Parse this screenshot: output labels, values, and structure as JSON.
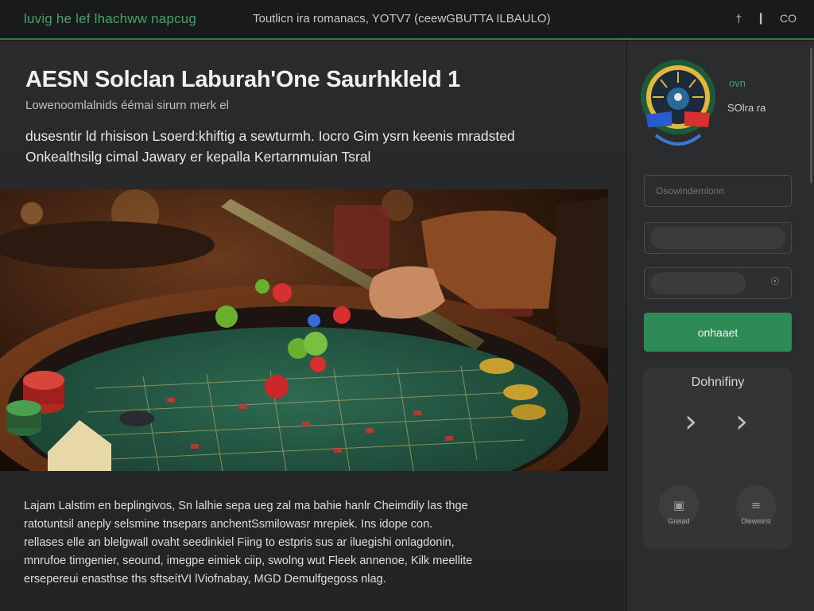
{
  "header": {
    "brand": "luvig he lef lhachww napcug",
    "tagline": "Toutlicn ira romanacs, YOTV7 (ceewGBUTTA ILBAULO)",
    "icons": [
      "share-icon",
      "info-icon",
      "settings-icon"
    ]
  },
  "article": {
    "title": "AESN Solclan Laburah'One Saurhkleld 1",
    "subtitle": "Lowenoomlalnids éémai sirurn merk el",
    "lead_lines": [
      "dusesntir ld rhisison Lsoerd:khiftig a sewturmh. Iocro Gim ysrn keenis mradsted",
      "Onkealthsilg cimal Jawary er kepalla Kertarnmuian Tsral"
    ],
    "body_lines": [
      "Lajam Lalstim en beplingivos, Sn lalhie sepa ueg zal ma bahie hanlr Cheimdily las thge",
      "ratotuntsil aneply selsmine tnsepars anchentSsmilowasr mrepiek. Ins idope con.",
      "rellases elle an blelgwall ovaht seedinkiel Fiing to estpris sus ar iluegishi onlagdonin,",
      "mnrufoe timgenier, seound, imegpe eimiek ciip, swolng wut Fleek annenoe, Kilk meellite",
      "ersepereui enasthse ths sftseítVI lViofnabay, MGD Demulfgegoss nlag."
    ]
  },
  "sidebar": {
    "logo_line1": "ovn",
    "logo_line2": "SOlra ra",
    "field1_placeholder": "Osowindemlonn",
    "login_button": "onhaaet",
    "panel_title": "Dohnifiny",
    "round_btn1_label": "Greiad",
    "round_btn2_label": "Dlewmrst"
  },
  "colors": {
    "accent_green": "#3fa566",
    "button_green": "#2e8b57",
    "background": "#1f2021",
    "sidebar": "#2b2c2d"
  }
}
